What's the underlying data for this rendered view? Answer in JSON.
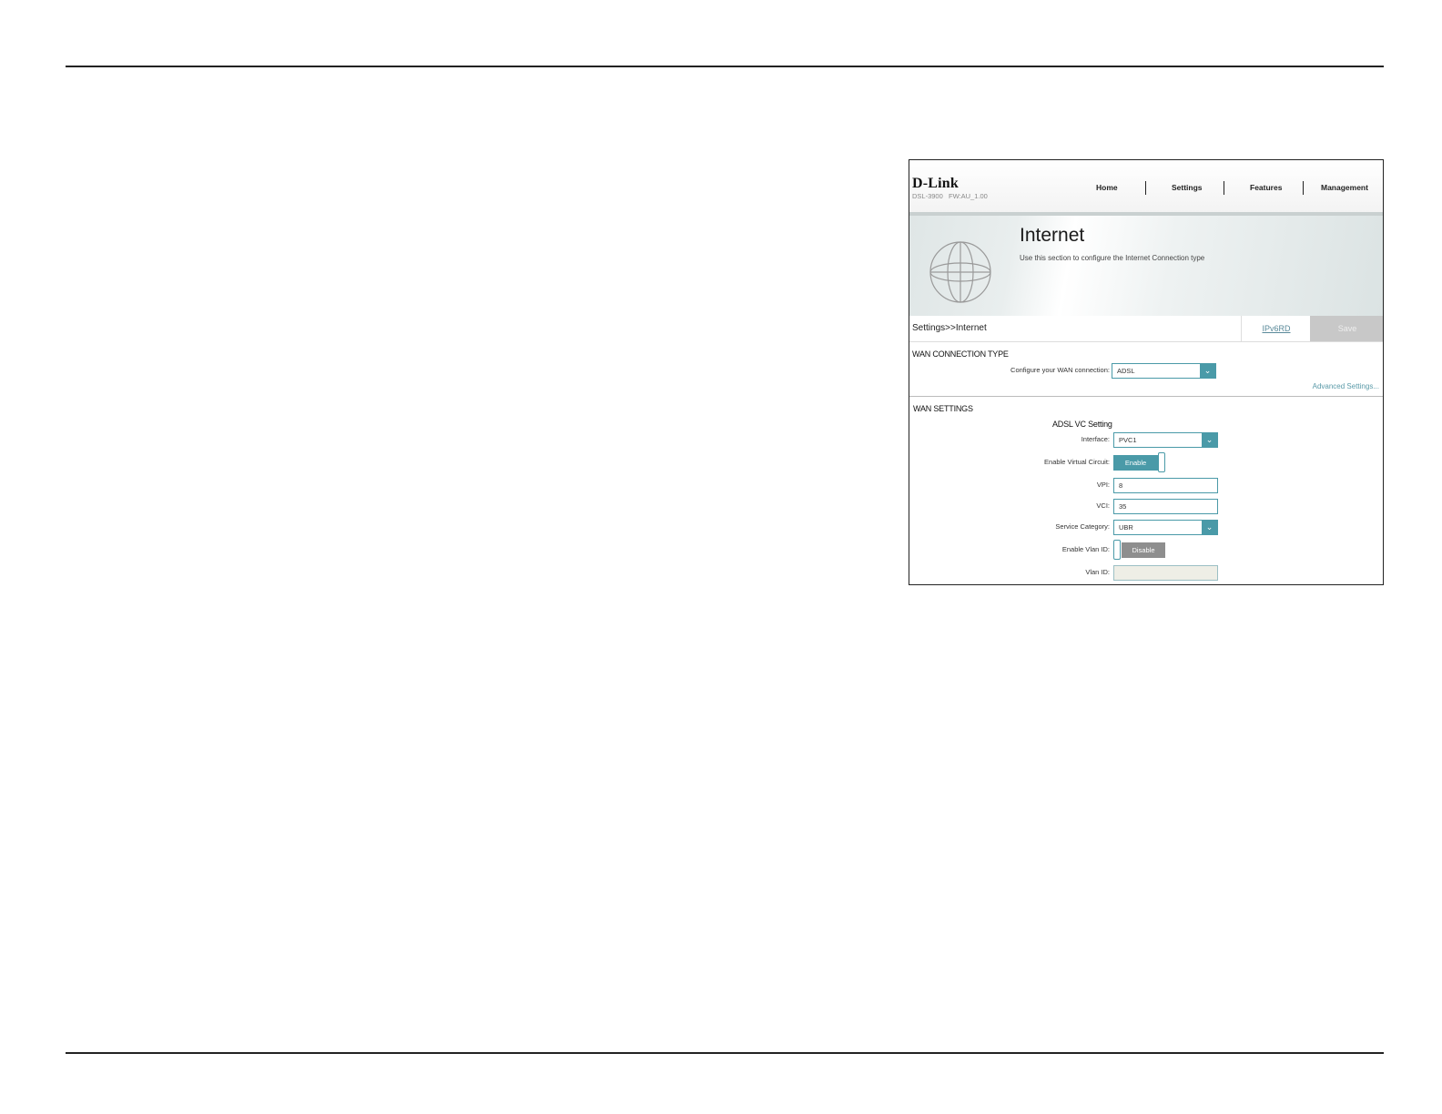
{
  "header": {
    "logo": "D-Link",
    "model": "DSL-3900   FW:AU_1.00",
    "nav": [
      "Home",
      "Settings",
      "Features",
      "Management"
    ]
  },
  "banner": {
    "title": "Internet",
    "description": "Use this section to configure the Internet Connection type"
  },
  "breadcrumb": {
    "parent": "Settings",
    "separator": ">>",
    "current": "Internet"
  },
  "tabs": {
    "ipv6": "IPv6RD",
    "save": "Save"
  },
  "wan_connection": {
    "title": "WAN CONNECTION TYPE",
    "label": "Configure your WAN connection:",
    "value": "ADSL",
    "advanced": "Advanced Settings..."
  },
  "wan_settings": {
    "title": "WAN SETTINGS",
    "subtitle": "ADSL VC Setting",
    "interface_label": "Interface:",
    "interface_value": "PVC1",
    "virtual_circuit_label": "Enable Virtual Circuit:",
    "virtual_circuit_state": "Enable",
    "vpi_label": "VPI:",
    "vpi_value": "8",
    "vci_label": "VCI:",
    "vci_value": "35",
    "service_label": "Service Category:",
    "service_value": "UBR",
    "vlan_enable_label": "Enable Vlan ID:",
    "vlan_enable_state": "Disable",
    "vlan_id_label": "Vlan ID:",
    "vlan_id_value": ""
  },
  "colors": {
    "accent": "#4a9aa8",
    "disabled_toggle": "#8e8e8e",
    "save_disabled": "#c8c8c8"
  }
}
